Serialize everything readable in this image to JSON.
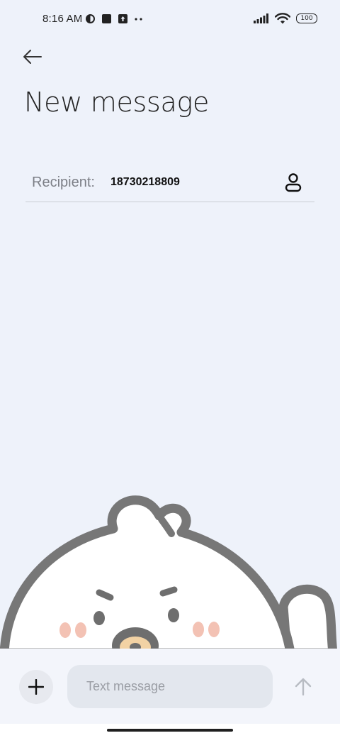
{
  "status_bar": {
    "time": "8:16 AM",
    "battery_level": "100",
    "icons_left": [
      "vpn-icon",
      "square-icon",
      "upload-icon",
      "more-dots-icon"
    ],
    "icons_right": [
      "signal-icon",
      "wifi-icon",
      "battery-icon"
    ]
  },
  "header": {
    "back_icon": "arrow-left-icon",
    "title": "New message"
  },
  "recipient": {
    "label": "Recipient:",
    "value": "18730218809",
    "contact_icon": "person-icon"
  },
  "composer": {
    "attach_icon": "plus-icon",
    "placeholder": "Text message",
    "value": "",
    "send_icon": "arrow-up-icon"
  },
  "colors": {
    "background": "#eef2fa",
    "input_background": "#e3e7ee",
    "mascot_outline": "#777777",
    "cheek": "#f3c2b4"
  }
}
